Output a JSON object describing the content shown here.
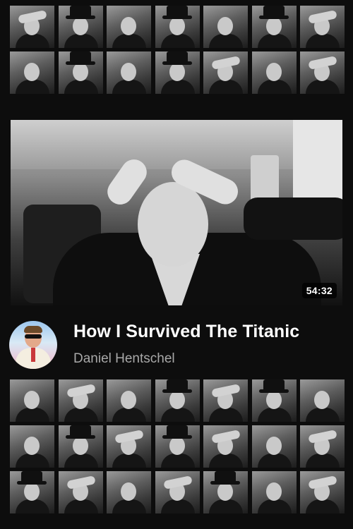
{
  "video": {
    "title": "How I Survived The Titanic",
    "author": "Daniel Hentschel",
    "duration": "54:32",
    "icon": "play-thumbnail"
  },
  "avatar": {
    "icon": "channel-avatar"
  },
  "colors": {
    "background": "#0d0d0d",
    "title_text": "#ffffff",
    "author_text": "#a8a8a8",
    "duration_bg": "#000000"
  },
  "thumbnail_grids": {
    "top": {
      "variants": [
        "hand",
        "hat",
        "plain",
        "hat",
        "plain",
        "hat",
        "hand",
        "plain",
        "hat",
        "plain",
        "hat",
        "hand",
        "plain",
        "hand"
      ]
    },
    "bottom": {
      "variants": [
        "plain",
        "hand",
        "plain",
        "hat",
        "hand",
        "hat",
        "plain",
        "plain",
        "hat",
        "hand",
        "hat",
        "hand",
        "plain",
        "hand",
        "hat",
        "hand",
        "plain",
        "hand",
        "hat",
        "plain",
        "hand"
      ]
    }
  }
}
